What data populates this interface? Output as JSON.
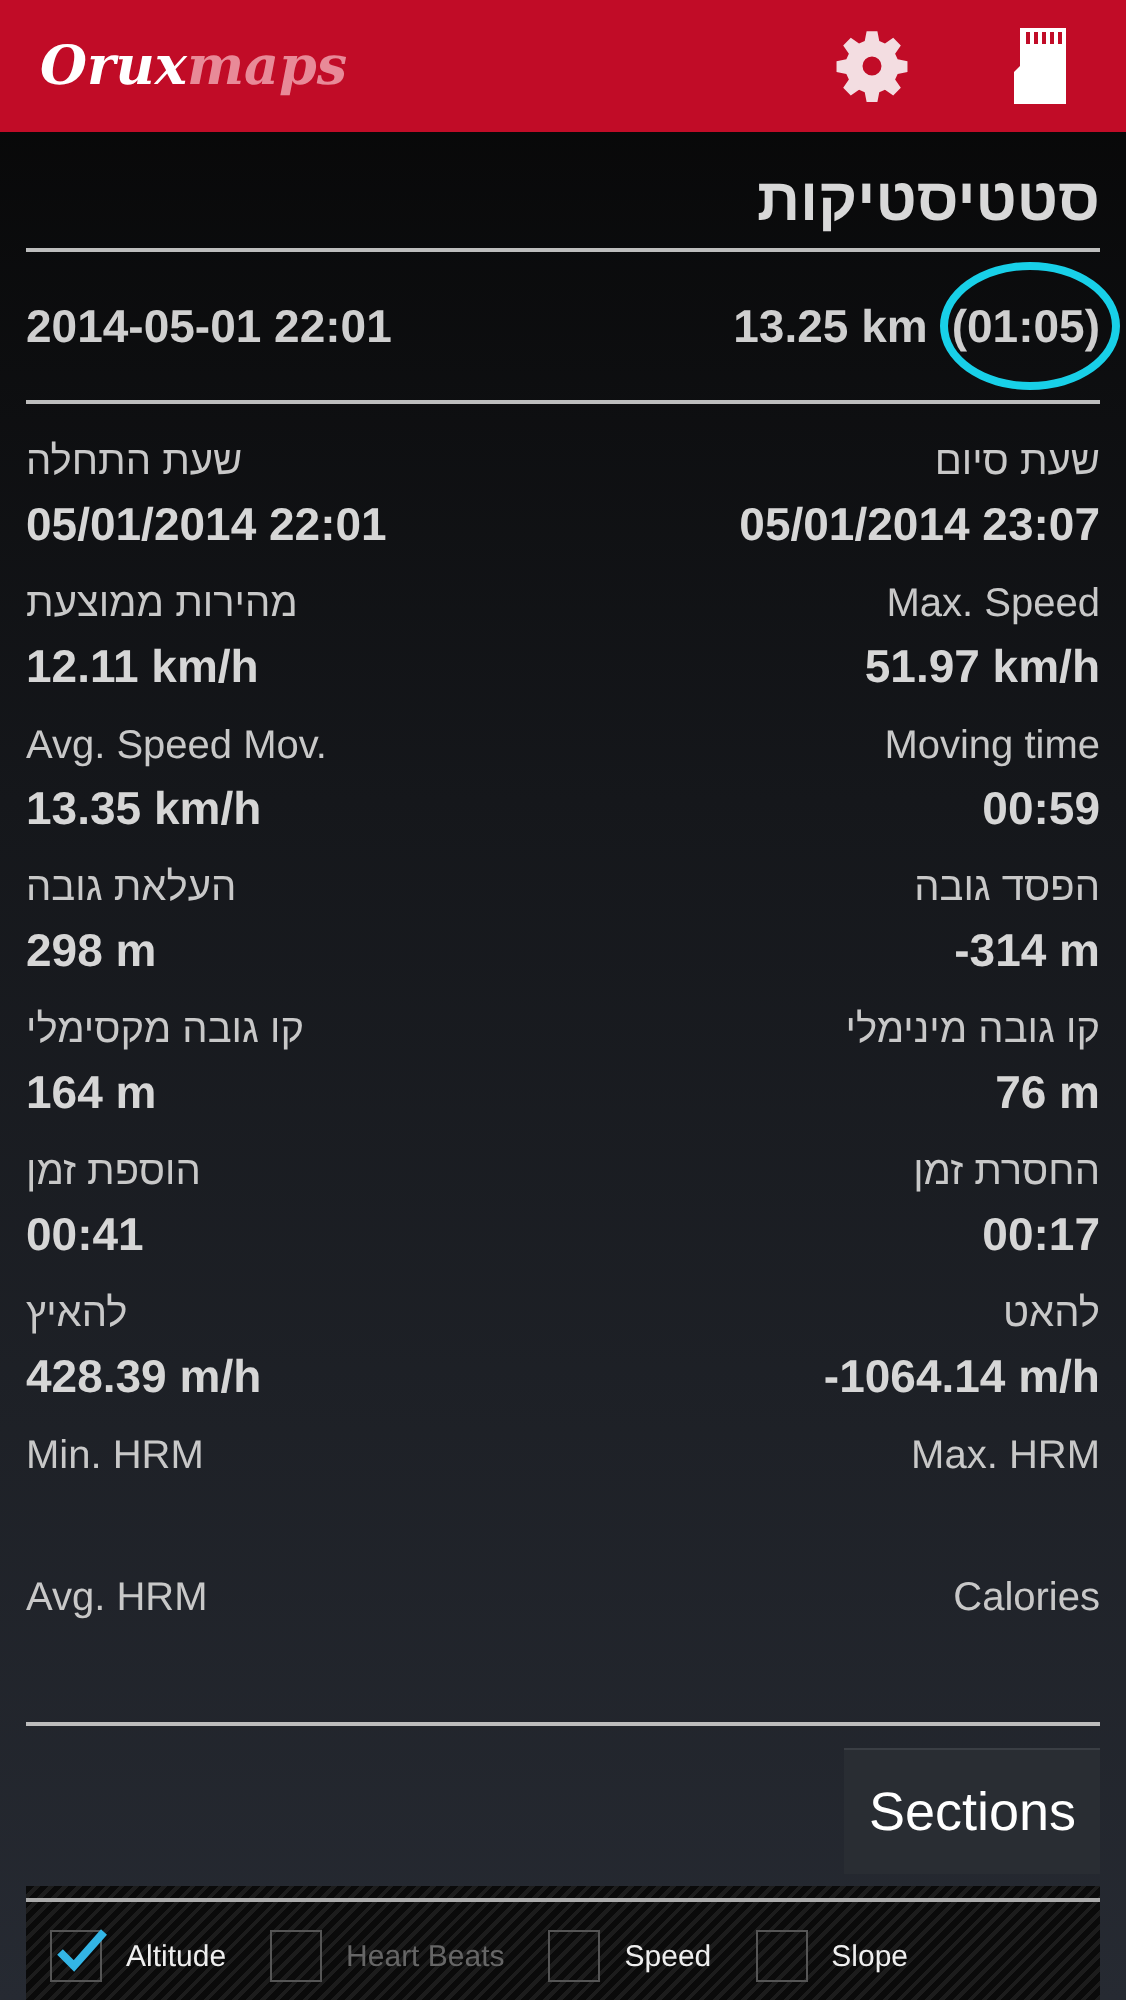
{
  "app_bar": {
    "logo_bold": "Orux",
    "logo_light": "maps"
  },
  "title": "סטטיסטיקות",
  "summary": {
    "date": "2014-05-01 22:01",
    "distance": "13.25 km",
    "duration": "(01:05)",
    "duration_highlighted": true
  },
  "stats": [
    {
      "left": {
        "label": "שעת התחלה",
        "value": "05/01/2014 22:01"
      },
      "right": {
        "label": "שעת סיום",
        "value": "05/01/2014 23:07"
      }
    },
    {
      "left": {
        "label": "מהירות ממוצעת",
        "value": "12.11 km/h"
      },
      "right": {
        "label": "Max. Speed",
        "value": "51.97 km/h"
      }
    },
    {
      "left": {
        "label": "Avg. Speed Mov.",
        "value": "13.35 km/h"
      },
      "right": {
        "label": "Moving time",
        "value": "00:59"
      }
    },
    {
      "left": {
        "label": "העלאת גובה",
        "value": "298 m"
      },
      "right": {
        "label": "הפסד גובה",
        "value": "-314 m"
      }
    },
    {
      "left": {
        "label": "קו גובה מקסימלי",
        "value": "164 m"
      },
      "right": {
        "label": "קו גובה מינימלי",
        "value": "76 m"
      }
    },
    {
      "left": {
        "label": "הוספת זמן",
        "value": "00:41"
      },
      "right": {
        "label": "החסרת זמן",
        "value": "00:17"
      }
    },
    {
      "left": {
        "label": "להאיץ",
        "value": "428.39 m/h"
      },
      "right": {
        "label": "להאט",
        "value": "-1064.14 m/h"
      }
    },
    {
      "left": {
        "label": "Min. HRM"
      },
      "right": {
        "label": "Max. HRM"
      }
    },
    {
      "left": {
        "label": "Avg. HRM"
      },
      "right": {
        "label": "Calories"
      }
    }
  ],
  "sections_button": "Sections",
  "graph_options": [
    {
      "label": "Altitude",
      "checked": true,
      "disabled": false
    },
    {
      "label": "Heart Beats",
      "checked": false,
      "disabled": true
    },
    {
      "label": "Speed",
      "checked": false,
      "disabled": false
    },
    {
      "label": "Slope",
      "checked": false,
      "disabled": false
    }
  ]
}
